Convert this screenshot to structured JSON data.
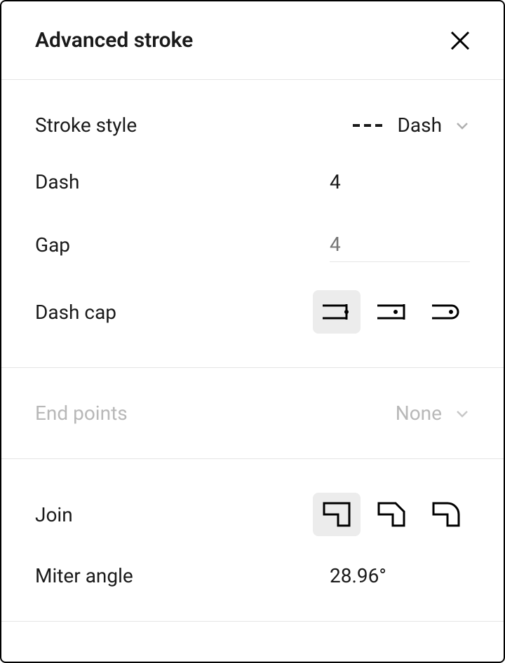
{
  "header": {
    "title": "Advanced stroke"
  },
  "stroke_style": {
    "label": "Stroke style",
    "selected": "Dash"
  },
  "dash": {
    "label": "Dash",
    "value": "4"
  },
  "gap": {
    "label": "Gap",
    "placeholder": "4"
  },
  "dash_cap": {
    "label": "Dash cap"
  },
  "end_points": {
    "label": "End points",
    "selected": "None"
  },
  "join": {
    "label": "Join"
  },
  "miter_angle": {
    "label": "Miter angle",
    "value": "28.96°"
  }
}
